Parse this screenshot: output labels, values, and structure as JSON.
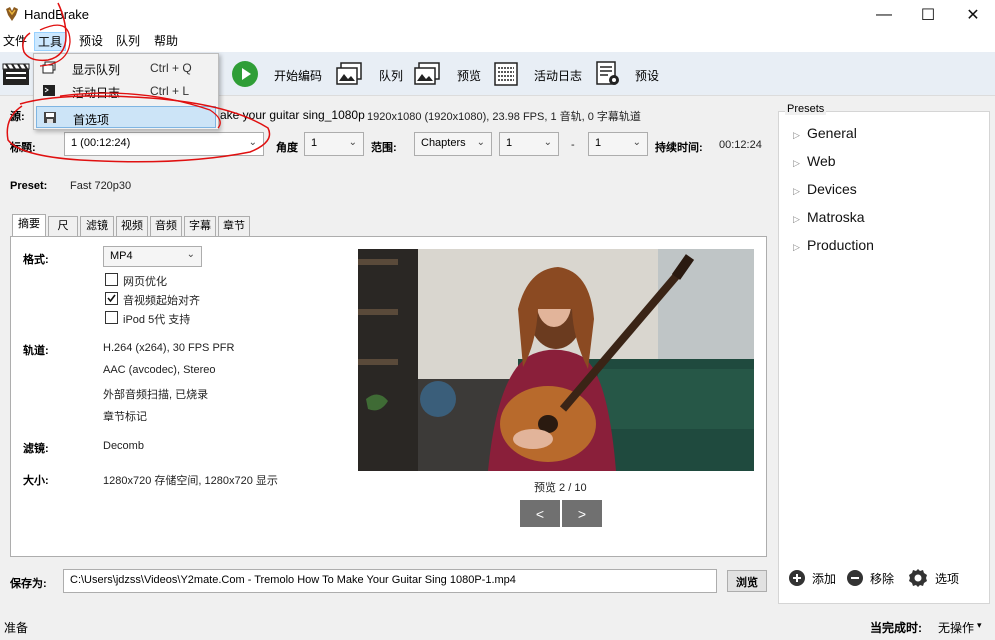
{
  "app": {
    "title": "HandBrake"
  },
  "window_controls": {
    "minimize": "—",
    "maximize": "☐",
    "close": "✕"
  },
  "menubar": {
    "items": [
      "文件",
      "工具",
      "预设",
      "队列",
      "帮助"
    ]
  },
  "tools_menu": {
    "items": [
      {
        "label": "显示队列",
        "shortcut": "Ctrl + Q",
        "icon": "queue-icon"
      },
      {
        "label": "活动日志",
        "shortcut": "Ctrl + L",
        "icon": "console-icon"
      },
      {
        "label": "首选项",
        "shortcut": "",
        "icon": "save-icon"
      }
    ]
  },
  "toolbar": {
    "start_encode": "开始编码",
    "queue": "队列",
    "preview": "预览",
    "activity_log": "活动日志",
    "presets": "预设"
  },
  "source": {
    "label": "源:",
    "name": "ake your guitar sing_1080p",
    "info": "1920x1080 (1920x1080), 23.98 FPS, 1 音轨, 0 字幕轨道"
  },
  "title_row": {
    "title_label": "标题:",
    "title_value": "1 (00:12:24)",
    "angle_label": "角度",
    "angle_value": "1",
    "range_label": "范围:",
    "range_type": "Chapters",
    "range_start": "1",
    "range_sep": "-",
    "range_end": "1",
    "duration_label": "持续时间:",
    "duration_value": "00:12:24"
  },
  "preset_row": {
    "label": "Preset:",
    "value": "Fast 720p30"
  },
  "tabs": [
    "摘要",
    "尺寸",
    "滤镜",
    "视频",
    "音频",
    "字幕",
    "章节"
  ],
  "summary": {
    "format_label": "格式:",
    "format_value": "MP4",
    "options": [
      {
        "label": "网页优化",
        "checked": false
      },
      {
        "label": "音视频起始对齐",
        "checked": true
      },
      {
        "label": "iPod 5代 支持",
        "checked": false
      }
    ],
    "tracks_label": "轨道:",
    "tracks": [
      "H.264 (x264), 30 FPS PFR",
      "AAC (avcodec), Stereo",
      "外部音频扫描, 已烧录",
      "章节标记"
    ],
    "filters_label": "滤镜:",
    "filters_value": "Decomb",
    "size_label": "大小:",
    "size_value": "1280x720 存储空间, 1280x720 显示"
  },
  "preview": {
    "caption": "预览 2 / 10",
    "prev": "<",
    "next": ">"
  },
  "save": {
    "label": "保存为:",
    "path": "C:\\Users\\jdzss\\Videos\\Y2mate.Com - Tremolo How To Make Your Guitar Sing 1080P-1.mp4",
    "browse": "浏览"
  },
  "presets_panel": {
    "title": "Presets",
    "items": [
      "General",
      "Web",
      "Devices",
      "Matroska",
      "Production"
    ],
    "add": "添加",
    "remove": "移除",
    "options": "选项"
  },
  "status": {
    "left": "准备",
    "when_done_label": "当完成时:",
    "when_done_value": "无操作"
  },
  "colors": {
    "annotation": "#e01010",
    "toolbar_bg": "#e8eef5",
    "highlight": "#cce4f7",
    "play_green": "#2f9e37"
  }
}
